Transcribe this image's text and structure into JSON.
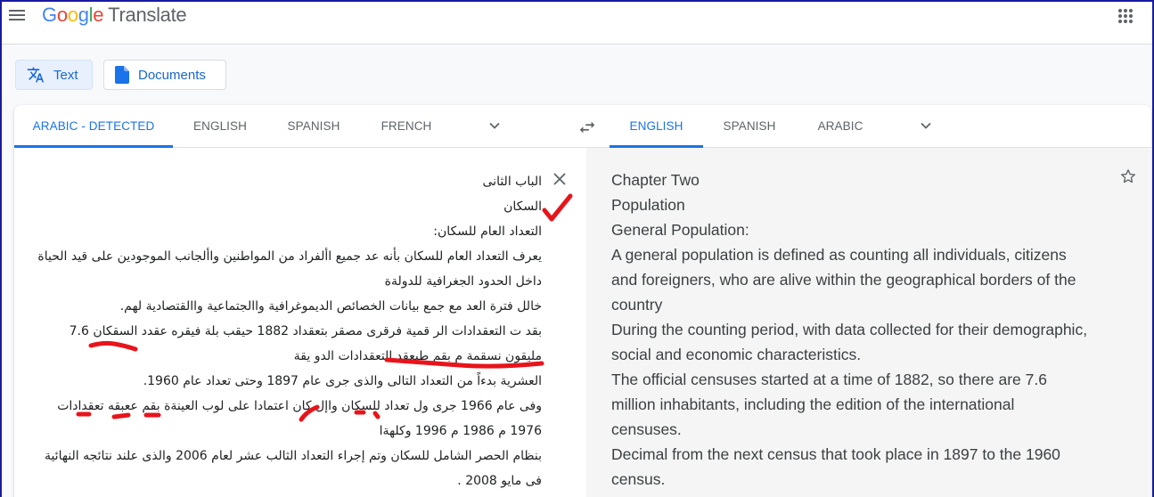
{
  "header": {
    "logo_letters": [
      "G",
      "o",
      "o",
      "g",
      "l",
      "e"
    ],
    "product_name": "Translate",
    "menu_icon": "hamburger-menu-icon",
    "apps_icon": "apps-grid-icon"
  },
  "modes": [
    {
      "label": "Text",
      "icon": "translate-icon",
      "active": true
    },
    {
      "label": "Documents",
      "icon": "document-icon",
      "active": false
    }
  ],
  "source_languages": {
    "tabs": [
      {
        "label": "ARABIC - DETECTED",
        "active": true
      },
      {
        "label": "ENGLISH",
        "active": false
      },
      {
        "label": "SPANISH",
        "active": false
      },
      {
        "label": "FRENCH",
        "active": false
      }
    ],
    "more_icon": "chevron-down-icon"
  },
  "swap_icon": "swap-languages-icon",
  "target_languages": {
    "tabs": [
      {
        "label": "ENGLISH",
        "active": true
      },
      {
        "label": "SPANISH",
        "active": false
      },
      {
        "label": "ARABIC",
        "active": false
      }
    ],
    "more_icon": "chevron-down-icon"
  },
  "source_text": {
    "lines": [
      "الباب الثانى",
      "السكان",
      "التعداد العام للسكان:",
      "يعرف التعداد العام للسكان بأنه عد جميع األفراد من المواطنين واألجانب الموجودين على قيد الحياة",
      "داخل الحدود الجغرافية للدولةة",
      "خالل فترة العد مع جمع بيانات الخصائص الديموغرافية واالجتماعية واالقتصادية لهم.",
      "بقد ت التعقدادات الر قمية فرقرى مصقر بتعقداد 1882 حيقب بلة فيقره عقدد السقكان 7.6",
      "مليقون نسقمة م بقم طبعقد التعقدادات الدو يقة",
      "العشرية بدءاً من التعداد التالى والذى جرى عام 1897 وحتى تعداد عام 1960.",
      "وفى عام 1966 جرى ول تعداد للسكان واإل كان اعتمادا على لوب العينةة بقم ععبقه تعقدادات",
      "1976 م 1986 م 1996 وكلهةا",
      "بنظام الحصر الشامل للسكان وتم إجراء التعداد الثالب عشر لعام 2006 والذى علند نتائجه النهائية",
      "فى مايو 2008 ."
    ],
    "clear_icon": "close-icon"
  },
  "translation": {
    "lines": [
      "Chapter Two",
      "Population",
      "General Population:",
      "A general population is defined as counting all individuals, citizens",
      "and foreigners, who are alive within the geographical borders of the",
      "country",
      "During the counting period, with data collected for their demographic,",
      "social and economic characteristics.",
      "The official censuses started at a time of 1882, so there are 7.6",
      "million inhabitants, including the edition of the international",
      "censuses.",
      "Decimal from the next census that took place in 1897 to the 1960",
      "census."
    ],
    "save_icon": "star-icon"
  },
  "annotations": {
    "color": "#e8141b",
    "items": [
      "checkmark",
      "underline-marks"
    ]
  }
}
